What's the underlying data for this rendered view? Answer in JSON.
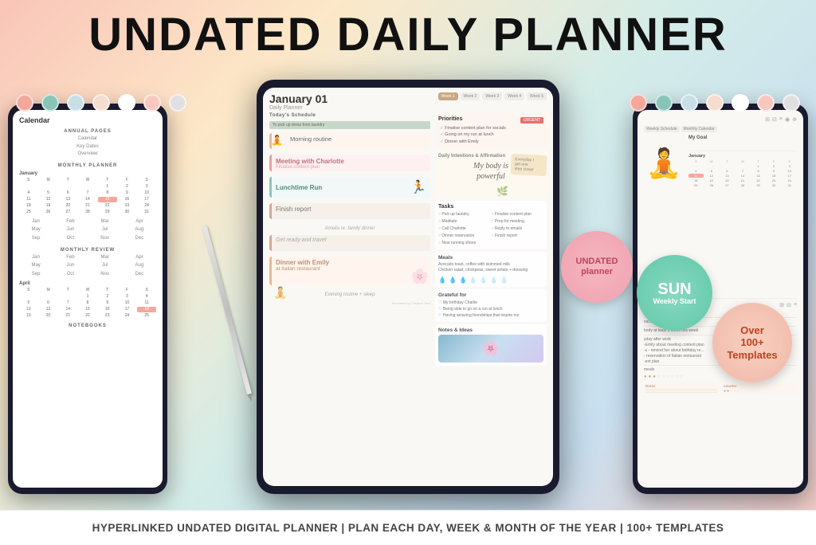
{
  "title": "UNDATED DAILY PLANNER",
  "background_colors": [
    "#f9c5b8",
    "#fde8c8",
    "#d4ece8",
    "#c8dff0"
  ],
  "dots_left": [
    "#f4a89a",
    "#88c5b8",
    "#c8dfe8",
    "#f5ddd0",
    "#ffffff",
    "#f8c8c0",
    "#e8e8e8"
  ],
  "dots_right": [
    "#f4a89a",
    "#88c5b8",
    "#c8dfe8",
    "#f5ddd0",
    "#ffffff",
    "#f8c8c0",
    "#e8e8e8"
  ],
  "bottom_banner": "HYPERLINKED UNDATED DIGITAL PLANNER  |  PLAN EACH DAY, WEEK & MONTH OF THE YEAR  |  100+ TEMPLATES",
  "planner": {
    "date": "January 01",
    "subtitle": "Daily Planner",
    "week_tabs": [
      "Week 1",
      "Week 2",
      "Week 3",
      "Week 4",
      "Week 5"
    ],
    "todays_schedule_label": "Today's Schedule",
    "schedule_items": [
      "Morning routine",
      "Meeting with Charlotte",
      "Finalise content plan",
      "Lunchtime Run",
      "Finish report",
      "Amelia re. family dinner",
      "Get ready and travel",
      "Dinner with Emily at Italian restaurant",
      "Evening routine + sleep"
    ],
    "priorities_title": "Priorities",
    "priorities_urgent": "URGENT",
    "priorities_items": [
      "Finalise content plan for socials",
      "Going on my run at lunch",
      "Dinner with Emily"
    ],
    "intentions_title": "Daily Intentions & Affirmation",
    "affirmation": "My body is powerful",
    "sticky_note": "Everyday I get one step closer",
    "tasks_title": "Tasks",
    "tasks": [
      "Pick up laundry",
      "Finalise content plan",
      "Meditate",
      "Prep for meeting",
      "Call Charlotte",
      "Reply to emails",
      "Dinner reservation",
      "Finish report",
      "New running shoes"
    ],
    "meals_title": "Meals",
    "meals": [
      "Avocado toast, coffee with skimmed milk",
      "Chicken salad, chickpeas, sweet potato + dressing"
    ],
    "grateful_title": "Grateful for",
    "grateful_items": [
      "My birthday Charlie",
      "Being able to go on a run at lunch",
      "Having amazing friendships that inspire me"
    ],
    "notes_title": "Notes & Ideas"
  },
  "calendar_left": {
    "title": "Calendar",
    "annual_pages_label": "ANNUAL PAGES",
    "annual_links": [
      "Calendar",
      "Key Dates",
      "Overview"
    ],
    "monthly_planner_label": "MONTHLY PLANNER",
    "monthly_review_label": "MONTHLY REVIEW",
    "notebooks_label": "NOTEBOOKS",
    "months": [
      "January",
      "April",
      "July",
      "October"
    ]
  },
  "badge_undated": {
    "line1": "UNDATED",
    "line2": "planner"
  },
  "badge_sun": {
    "main": "SUN",
    "sub": "Weekly Start"
  },
  "badge_templates": {
    "line1": "Over",
    "line2": "100+",
    "line3": "Templates"
  },
  "right_tablet": {
    "goal_label": "My Goal",
    "month_label": "January"
  }
}
